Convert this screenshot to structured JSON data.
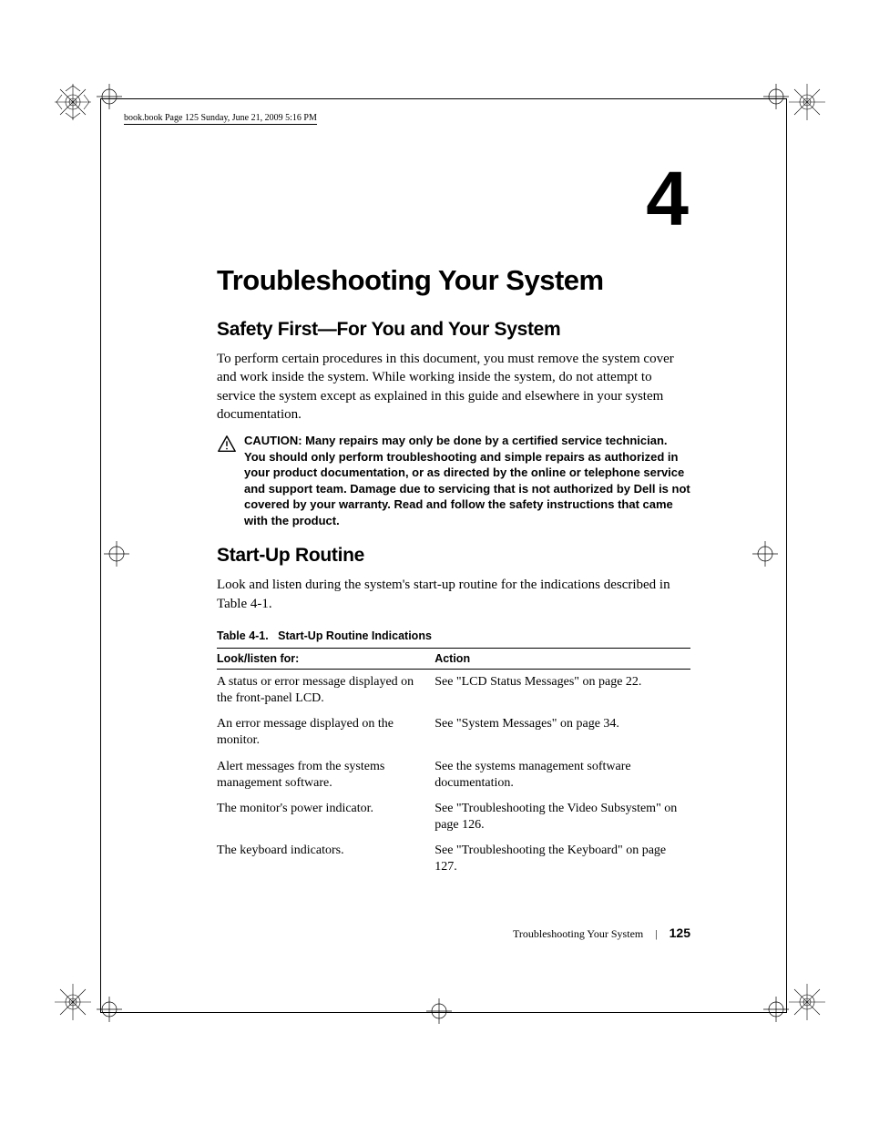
{
  "header_line": "book.book  Page 125  Sunday, June 21, 2009  5:16 PM",
  "chapter_number": "4",
  "chapter_title": "Troubleshooting Your System",
  "section1": {
    "heading": "Safety First—For You and Your System",
    "paragraph": "To perform certain procedures in this document, you must remove the system cover and work inside the system. While working inside the system, do not attempt to service the system except as explained in this guide and elsewhere in your system documentation."
  },
  "caution": {
    "label": "CAUTION: ",
    "text": "Many repairs may only be done by a certified service technician. You should only perform troubleshooting and simple repairs as authorized in your product documentation, or as directed by the online or telephone service and support team. Damage due to servicing that is not authorized by Dell is not covered by your warranty. Read and follow the safety instructions that came with the product."
  },
  "section2": {
    "heading": "Start-Up Routine",
    "paragraph": "Look and listen during the system's start-up routine for the indications described in Table 4-1."
  },
  "table": {
    "caption_prefix": "Table 4-1.",
    "caption_title": "Start-Up Routine Indications",
    "col1": "Look/listen for:",
    "col2": "Action",
    "rows": [
      {
        "look": "A status or error message displayed on the front-panel LCD.",
        "action": "See \"LCD Status Messages\" on page 22."
      },
      {
        "look": "An error message displayed on the monitor.",
        "action": "See \"System Messages\" on page 34."
      },
      {
        "look": "Alert messages from the systems management software.",
        "action": "See the systems management software documentation."
      },
      {
        "look": "The monitor's power indicator.",
        "action": "See \"Troubleshooting the Video Subsystem\" on page 126."
      },
      {
        "look": "The keyboard indicators.",
        "action": "See \"Troubleshooting the Keyboard\" on page 127."
      }
    ]
  },
  "footer": {
    "section_name": "Troubleshooting Your System",
    "page_number": "125"
  }
}
